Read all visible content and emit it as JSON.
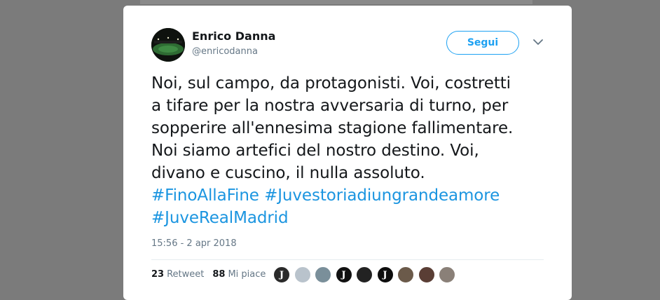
{
  "tweet": {
    "author": {
      "display_name": "Enrico Danna",
      "handle": "@enricodanna",
      "avatar_icon": "stadium-avatar-icon"
    },
    "follow_label": "Segui",
    "text_lines": [
      "Noi, sul campo, da protagonisti. Voi, costretti",
      "a tifare per la nostra avversaria di turno, per",
      "sopperire all'ennesima stagione fallimentare.",
      "Noi siamo artefici del nostro destino. Voi,",
      "divano e cuscino, il nulla assoluto."
    ],
    "hashtags_line1": [
      "#FinoAllaFine",
      "#Juvestoriadiungrandeamore"
    ],
    "hashtags_line2": [
      "#JuveRealMadrid"
    ],
    "timestamp": "15:56 - 2 apr 2018",
    "retweets": {
      "count": "23",
      "label": "Retweet"
    },
    "likes": {
      "count": "88",
      "label": "Mi piace"
    },
    "liker_avatars": [
      {
        "name": "liker-avatar-1",
        "color": "#2a2a2a"
      },
      {
        "name": "liker-avatar-2",
        "color": "#b9c3cc"
      },
      {
        "name": "liker-avatar-3",
        "color": "#7a8f9a"
      },
      {
        "name": "liker-avatar-4",
        "color": "#111111"
      },
      {
        "name": "liker-avatar-5",
        "color": "#222222"
      },
      {
        "name": "liker-avatar-6",
        "color": "#0d0d0d"
      },
      {
        "name": "liker-avatar-7",
        "color": "#6b5a4a"
      },
      {
        "name": "liker-avatar-8",
        "color": "#5a3e35"
      },
      {
        "name": "liker-avatar-9",
        "color": "#8a8078"
      }
    ]
  },
  "colors": {
    "hashtag": "#1b95e0",
    "follow_border": "#1da1f2",
    "muted_text": "#657786"
  }
}
